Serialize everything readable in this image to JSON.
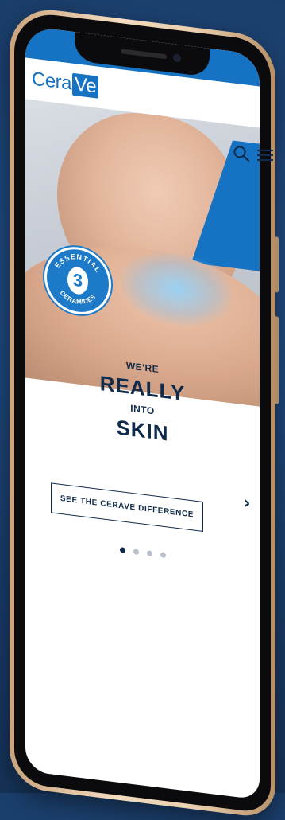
{
  "brand": {
    "logo_text_main": "Cera",
    "logo_text_box": "Ve",
    "accent_color": "#1673c3",
    "navy_color": "#0f2a4a"
  },
  "header": {
    "icons": [
      "search-icon",
      "menu-icon"
    ]
  },
  "hero": {
    "badge_top": "ESSENTIAL",
    "badge_number": "3",
    "badge_bottom": "CERAMIDES"
  },
  "tagline": {
    "line1": "WE'RE",
    "line2": "REALLY",
    "line3": "INTO",
    "line4": "SKIN"
  },
  "cta": {
    "label": "SEE THE CERAVE DIFFERENCE"
  },
  "carousel": {
    "total_slides": 4,
    "active_slide": 1
  }
}
